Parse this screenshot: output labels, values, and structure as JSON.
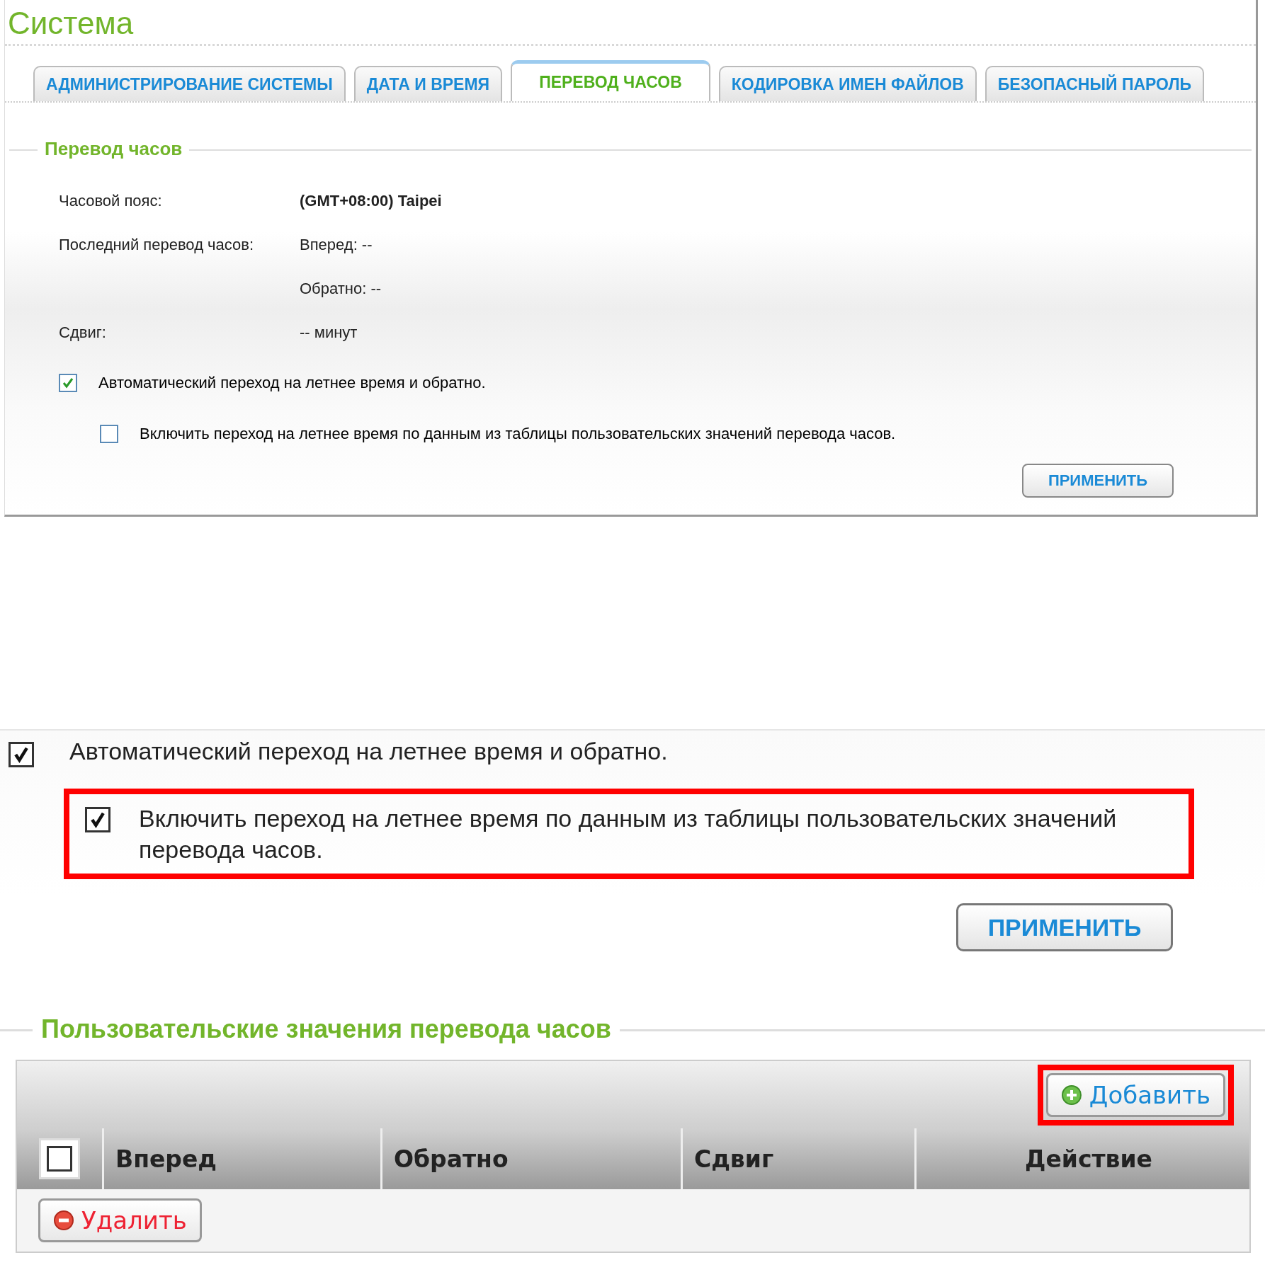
{
  "top_panel": {
    "title": "Система",
    "tabs": [
      {
        "label": "АДМИНИСТРИРОВАНИЕ СИСТЕМЫ",
        "selected": false
      },
      {
        "label": "ДАТА И ВРЕМЯ",
        "selected": false
      },
      {
        "label": "ПЕРЕВОД ЧАСОВ",
        "selected": true
      },
      {
        "label": "КОДИРОВКА ИМЕН ФАЙЛОВ",
        "selected": false
      },
      {
        "label": "БЕЗОПАСНЫЙ ПАРОЛЬ",
        "selected": false
      }
    ],
    "section_title": "Перевод часов",
    "fields": [
      {
        "label": "Часовой пояс:",
        "value": "(GMT+08:00) Taipei",
        "bold": true
      },
      {
        "label": "Последний перевод часов:",
        "value": "Вперед: --",
        "bold": false
      },
      {
        "value": "Обратно: --",
        "bold": false
      },
      {
        "label": "Сдвиг:",
        "value": "-- минут",
        "bold": false
      }
    ],
    "checkboxes": [
      {
        "label": "Автоматический переход на летнее время и обратно.",
        "checked": true,
        "indented": false
      },
      {
        "label": "Включить переход на летнее время по данным из таблицы пользовательских значений перевода часов.",
        "checked": false,
        "indented": true
      }
    ],
    "apply_button": "ПРИМЕНИТЬ"
  },
  "zoomed_panel": {
    "checkboxes": [
      {
        "label": "Автоматический переход на летнее время и обратно.",
        "checked": true,
        "highlighted": false
      },
      {
        "label": "Включить переход на летнее время по данным из таблицы пользовательских значений перевода часов.",
        "checked": true,
        "highlighted": true
      }
    ],
    "apply_button": "ПРИМЕНИТЬ",
    "section_title": "Пользовательские значения перевода часов",
    "table": {
      "add_button": {
        "label": "Добавить",
        "highlighted": true
      },
      "select_all": {
        "checked": false
      },
      "columns": [
        "Вперед",
        "Обратно",
        "Сдвиг",
        "Действие"
      ],
      "delete_button": "Удалить"
    }
  }
}
